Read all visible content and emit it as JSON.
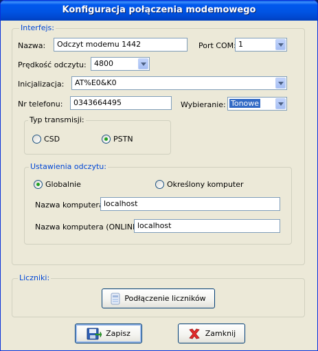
{
  "window": {
    "title": "Konfiguracja połączenia modemowego"
  },
  "interfejs": {
    "legend": "Interfejs:",
    "nazwa_label": "Nazwa:",
    "nazwa_value": "Odczyt modemu 1442",
    "port_label": "Port COM:",
    "port_value": "1",
    "predkosc_label": "Prędkość odczytu:",
    "predkosc_value": "4800",
    "inicjalizacja_label": "Inicjalizacja:",
    "inicjalizacja_value": "AT%E0&K0",
    "telefon_label": "Nr telefonu:",
    "telefon_value": "0343664495",
    "wybieranie_label": "Wybieranie:",
    "wybieranie_value": "Tonowe",
    "typ": {
      "legend": "Typ transmisji:",
      "csd_label": "CSD",
      "pstn_label": "PSTN",
      "selected": "PSTN"
    }
  },
  "ustawienia": {
    "legend": "Ustawienia odczytu:",
    "globalnie_label": "Globalnie",
    "okreslony_label": "Określony komputer",
    "selected": "Globalnie",
    "nazwa_komp_label": "Nazwa komputera:",
    "nazwa_komp_value": "localhost",
    "nazwa_online_label": "Nazwa komputera (ONLINE):",
    "nazwa_online_value": "localhost"
  },
  "liczniki": {
    "legend": "Liczniki:",
    "button_label": "Podłączenie liczników"
  },
  "buttons": {
    "zapisz": "Zapisz",
    "zamknij": "Zamknij"
  },
  "colors": {
    "title_bar": "#0054e3",
    "group_legend": "#0046d5",
    "selection": "#316ac5",
    "radio_dot": "#21a121"
  }
}
